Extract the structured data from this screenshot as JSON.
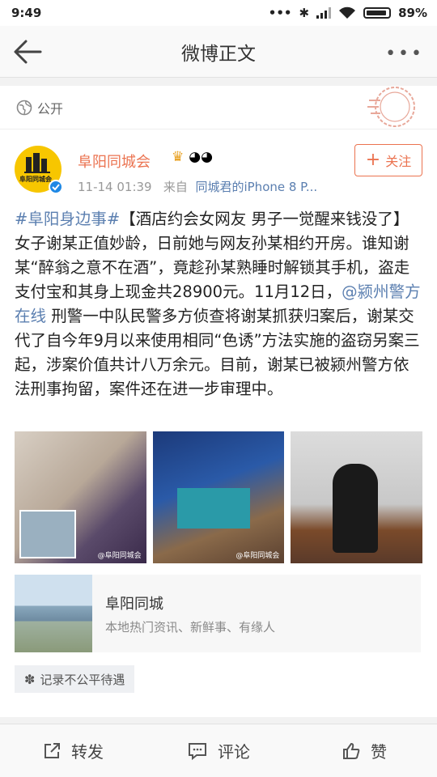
{
  "status": {
    "time": "9:49",
    "battery": "89%"
  },
  "nav": {
    "title": "微博正文"
  },
  "visibility": {
    "label": "公开"
  },
  "post": {
    "author": "阜阳同城会",
    "avatar_text": "阜阳同城会",
    "time": "11-14 01:39",
    "from_label": "来自",
    "source": "同城君的iPhone 8 P...",
    "follow_label": "关注",
    "text_parts": {
      "hashtag": "#阜阳身边事#",
      "p1": "【酒店约会女网友 男子一觉醒来钱没了】女子谢某正值妙龄，日前她与网友孙某相约开房。谁知谢某“醉翁之意不在酒”，竟趁孙某熟睡时解锁其手机，盗走支付宝和其身上现金共28900元。11月12日，",
      "mention": "@颍州警方在线",
      "p2": " 刑警一中队民警多方侦查将谢某抓获归案后，谢某交代了自今年9月以来使用相同“色诱”方法实施的盗窃另案三起，涉案价值共计八万余元。目前，谢某已被颍州警方依法刑事拘留，案件还在进一步审理中。"
    },
    "photos": [
      {
        "name": "photo-1",
        "watermark": "@阜阳同城会"
      },
      {
        "name": "photo-2",
        "watermark": "@阜阳同城会"
      },
      {
        "name": "photo-3",
        "watermark": ""
      }
    ],
    "share": {
      "title": "阜阳同城",
      "subtitle": "本地热门资讯、新鲜事、有缘人"
    },
    "tag": "记录不公平待遇"
  },
  "toolbar": {
    "repost": "转发",
    "comment": "评论",
    "like": "赞"
  },
  "colors": {
    "accent": "#eb7350",
    "link": "#5b7fb0"
  }
}
